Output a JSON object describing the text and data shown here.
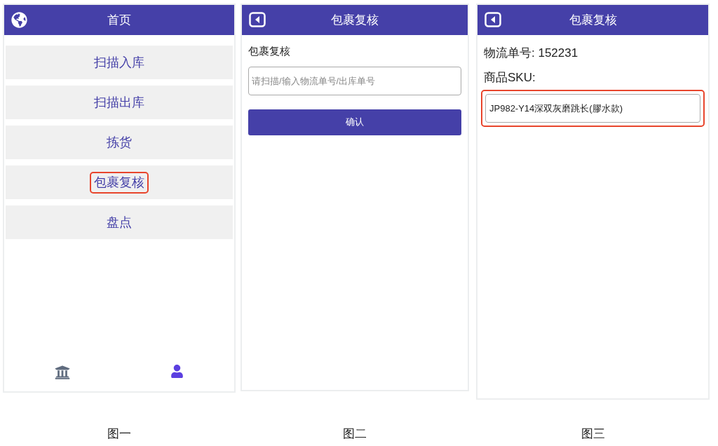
{
  "screens": [
    {
      "kind": "home",
      "header": {
        "title": "首页"
      },
      "menu": [
        {
          "label": "扫描入库",
          "highlighted": false
        },
        {
          "label": "扫描出库",
          "highlighted": false
        },
        {
          "label": "拣货",
          "highlighted": false
        },
        {
          "label": "包裹复核",
          "highlighted": true
        },
        {
          "label": "盘点",
          "highlighted": false
        }
      ],
      "tabbar": [
        {
          "kind": "bank",
          "selected": false
        },
        {
          "kind": "user",
          "selected": true
        }
      ],
      "caption": "图一"
    },
    {
      "kind": "scan",
      "header": {
        "title": "包裹复核"
      },
      "heading": "包裹复核",
      "input": {
        "placeholder": "请扫描/输入物流单号/出库单号",
        "highlighted": false
      },
      "button": "确认",
      "caption": "图二"
    },
    {
      "kind": "sku",
      "header": {
        "title": "包裹复核"
      },
      "tracking": "物流单号: 152231",
      "sku_label": "商品SKU:",
      "input": {
        "value": "JP982-Y14深双灰磨跳长(膠水款)",
        "highlighted": true
      },
      "caption": "图三"
    }
  ]
}
